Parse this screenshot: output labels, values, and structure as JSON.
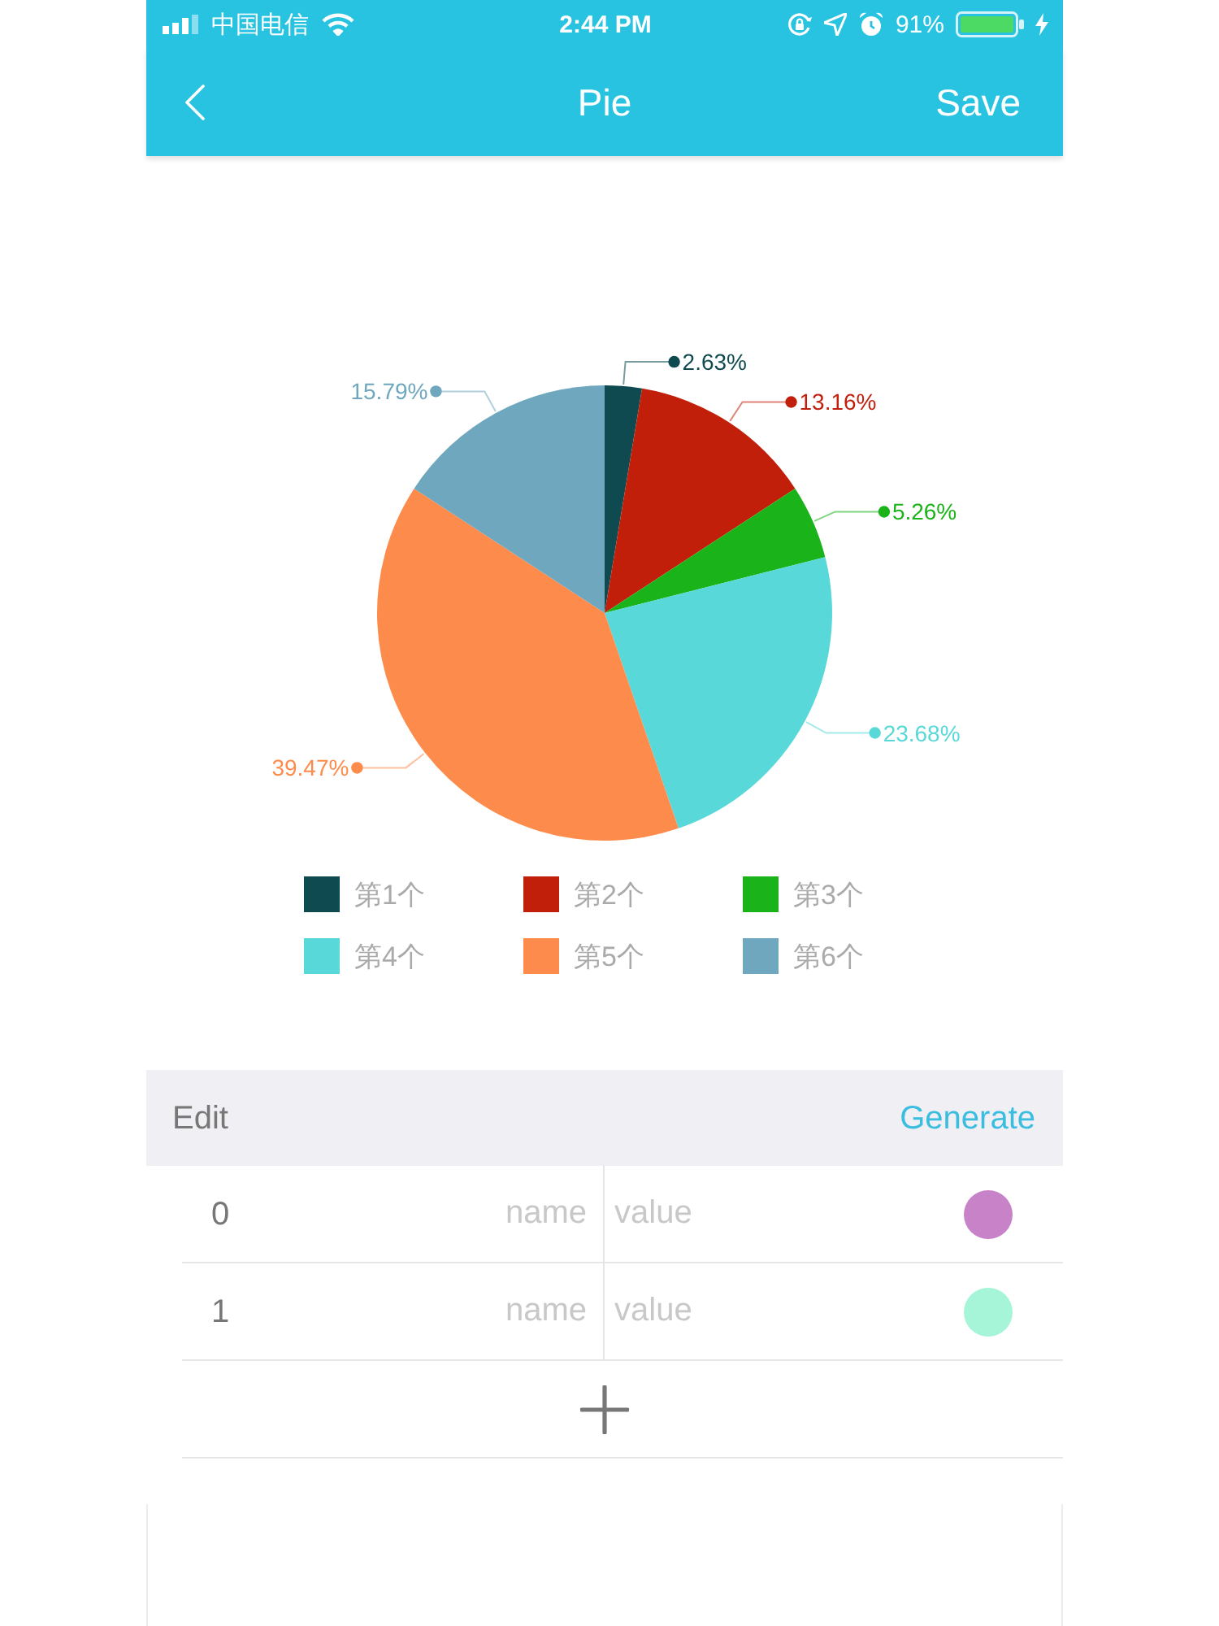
{
  "status_bar": {
    "carrier": "中国电信",
    "time": "2:44 PM",
    "battery": "91%"
  },
  "nav_bar": {
    "title": "Pie",
    "action": "Save"
  },
  "chart": {
    "chart_data": {
      "type": "pie",
      "categories": [
        "第1个",
        "第2个",
        "第3个",
        "第4个",
        "第5个",
        "第6个"
      ],
      "values": [
        2.63,
        13.16,
        5.26,
        23.68,
        39.47,
        15.79
      ],
      "value_labels": [
        "2.63%",
        "13.16%",
        "5.26%",
        "23.68%",
        "39.47%",
        "15.79%"
      ],
      "legend": "bottom"
    },
    "slices": [
      {
        "color": "#0e4a50"
      },
      {
        "color": "#c21f0b"
      },
      {
        "color": "#1ab31a"
      },
      {
        "color": "#58d8d8"
      },
      {
        "color": "#fd8c4c"
      },
      {
        "color": "#6ea7be"
      }
    ]
  },
  "editor": {
    "title": "Edit",
    "action": "Generate",
    "rows": [
      {
        "index": "0",
        "name": {
          "placeholder": "name"
        },
        "value": {
          "placeholder": "value"
        },
        "color": "#c882c8"
      },
      {
        "index": "1",
        "name": {
          "placeholder": "name"
        },
        "value": {
          "placeholder": "value"
        },
        "color": "#a6f5d8"
      }
    ]
  }
}
